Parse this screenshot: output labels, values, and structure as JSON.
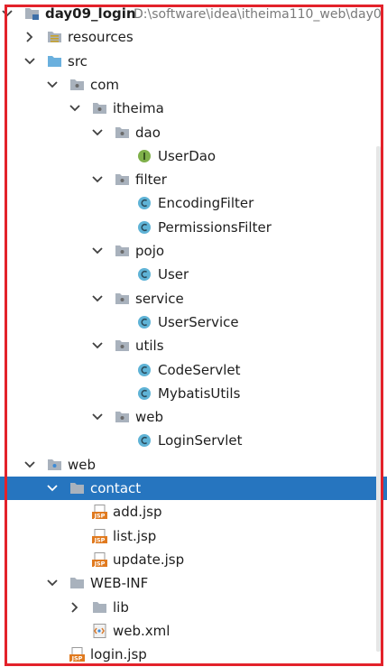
{
  "tree": [
    {
      "label": "day09_login",
      "path": "D:\\software\\idea\\itheima110_web\\day0",
      "icon": "module-folder-icon",
      "depth": 0,
      "expander": "expanded",
      "bold": true,
      "selected": false
    },
    {
      "label": "resources",
      "icon": "resources-folder-icon",
      "depth": 1,
      "expander": "collapsed",
      "bold": false,
      "selected": false
    },
    {
      "label": "src",
      "icon": "source-folder-icon",
      "depth": 1,
      "expander": "expanded",
      "bold": false,
      "selected": false
    },
    {
      "label": "com",
      "icon": "package-icon",
      "depth": 2,
      "expander": "expanded",
      "bold": false,
      "selected": false
    },
    {
      "label": "itheima",
      "icon": "package-icon",
      "depth": 3,
      "expander": "expanded",
      "bold": false,
      "selected": false
    },
    {
      "label": "dao",
      "icon": "package-icon",
      "depth": 4,
      "expander": "expanded",
      "bold": false,
      "selected": false
    },
    {
      "label": "UserDao",
      "icon": "interface-icon",
      "depth": 5,
      "expander": "none",
      "bold": false,
      "selected": false
    },
    {
      "label": "filter",
      "icon": "package-icon",
      "depth": 4,
      "expander": "expanded",
      "bold": false,
      "selected": false
    },
    {
      "label": "EncodingFilter",
      "icon": "class-icon",
      "depth": 5,
      "expander": "none",
      "bold": false,
      "selected": false
    },
    {
      "label": "PermissionsFilter",
      "icon": "class-icon",
      "depth": 5,
      "expander": "none",
      "bold": false,
      "selected": false
    },
    {
      "label": "pojo",
      "icon": "package-icon",
      "depth": 4,
      "expander": "expanded",
      "bold": false,
      "selected": false
    },
    {
      "label": "User",
      "icon": "class-icon",
      "depth": 5,
      "expander": "none",
      "bold": false,
      "selected": false
    },
    {
      "label": "service",
      "icon": "package-icon",
      "depth": 4,
      "expander": "expanded",
      "bold": false,
      "selected": false
    },
    {
      "label": "UserService",
      "icon": "class-icon",
      "depth": 5,
      "expander": "none",
      "bold": false,
      "selected": false
    },
    {
      "label": "utils",
      "icon": "package-icon",
      "depth": 4,
      "expander": "expanded",
      "bold": false,
      "selected": false
    },
    {
      "label": "CodeServlet",
      "icon": "class-icon",
      "depth": 5,
      "expander": "none",
      "bold": false,
      "selected": false
    },
    {
      "label": "MybatisUtils",
      "icon": "class-icon",
      "depth": 5,
      "expander": "none",
      "bold": false,
      "selected": false
    },
    {
      "label": "web",
      "icon": "package-icon",
      "depth": 4,
      "expander": "expanded",
      "bold": false,
      "selected": false
    },
    {
      "label": "LoginServlet",
      "icon": "class-icon",
      "depth": 5,
      "expander": "none",
      "bold": false,
      "selected": false
    },
    {
      "label": "web",
      "icon": "web-folder-icon",
      "depth": 1,
      "expander": "expanded",
      "bold": false,
      "selected": false
    },
    {
      "label": "contact",
      "icon": "folder-icon",
      "depth": 2,
      "expander": "expanded",
      "bold": false,
      "selected": true
    },
    {
      "label": "add.jsp",
      "icon": "jsp-file-icon",
      "depth": 3,
      "expander": "none",
      "bold": false,
      "selected": false
    },
    {
      "label": "list.jsp",
      "icon": "jsp-file-icon",
      "depth": 3,
      "expander": "none",
      "bold": false,
      "selected": false
    },
    {
      "label": "update.jsp",
      "icon": "jsp-file-icon",
      "depth": 3,
      "expander": "none",
      "bold": false,
      "selected": false
    },
    {
      "label": "WEB-INF",
      "icon": "folder-icon",
      "depth": 2,
      "expander": "expanded",
      "bold": false,
      "selected": false
    },
    {
      "label": "lib",
      "icon": "folder-icon",
      "depth": 3,
      "expander": "collapsed",
      "bold": false,
      "selected": false
    },
    {
      "label": "web.xml",
      "icon": "xml-file-icon",
      "depth": 3,
      "expander": "none",
      "bold": false,
      "selected": false
    },
    {
      "label": "login.jsp",
      "icon": "jsp-file-icon",
      "depth": 2,
      "expander": "none",
      "bold": false,
      "selected": false
    }
  ],
  "icon_badges": {
    "interface": "I",
    "jsp": "JSP"
  },
  "colors": {
    "selection": "#2675bf",
    "highlight_frame": "#e3222a",
    "folder": "#a9b2bd",
    "class": "#5fb3d6",
    "interface": "#7fb04a",
    "jsp": "#e07a1f",
    "xml": "#d97a2b"
  }
}
